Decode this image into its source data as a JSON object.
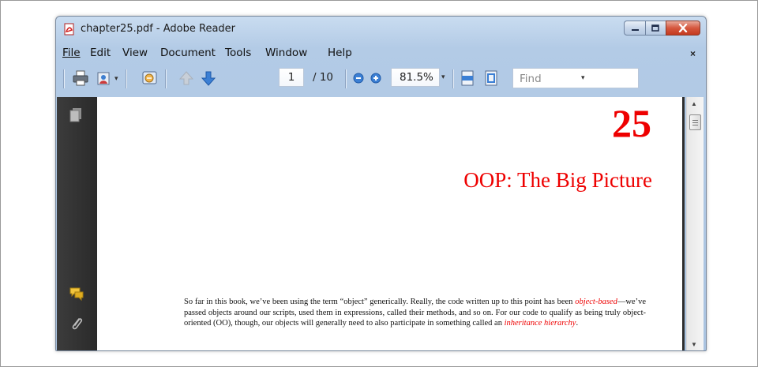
{
  "window": {
    "title": "chapter25.pdf - Adobe Reader"
  },
  "menu": {
    "file": "File",
    "edit": "Edit",
    "view": "View",
    "document": "Document",
    "tools": "Tools",
    "window": "Window",
    "help": "Help",
    "close_doc": "×"
  },
  "toolbar": {
    "page_current": "1",
    "page_total": "/ 10",
    "zoom_value": "81.5%",
    "find_placeholder": "Find"
  },
  "document": {
    "chapter_number": "25",
    "chapter_title": "OOP: The Big Picture",
    "paragraph": {
      "part1": "So far in this book, we’ve been using the term “object” generically. Really, the code written up to this point has been ",
      "term1": "object-based",
      "part2": "—we’ve passed objects around our scripts, used them in expressions, called their methods, and so on. For our code to qualify as being truly object-oriented (OO), though, our objects will generally need to also participate in something called an ",
      "term2": "inheritance hierarchy",
      "part3": "."
    }
  },
  "icons": [
    "pdf-icon",
    "print-icon",
    "share-icon",
    "collaborate-icon",
    "page-up-icon",
    "page-down-icon",
    "zoom-out-icon",
    "zoom-in-icon",
    "fit-width-icon",
    "fit-page-icon",
    "pages-icon",
    "comments-icon",
    "attachment-icon",
    "minimize-icon",
    "maximize-icon",
    "close-icon"
  ],
  "colors": {
    "accent_red": "#ee0000",
    "title_bar": "#b3cbe6",
    "nav_pane": "#2f2f2f"
  }
}
